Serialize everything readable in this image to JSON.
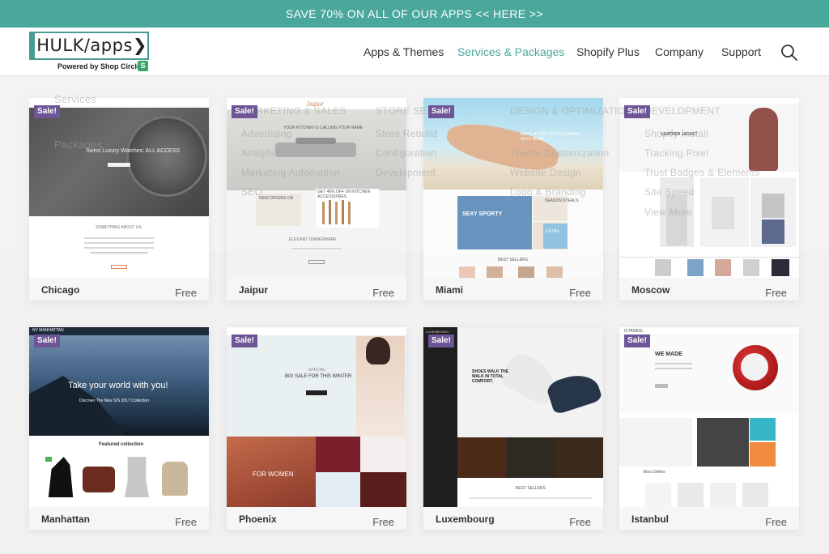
{
  "promo": {
    "text": "SAVE 70% ON ALL OF OUR APPS << HERE >>"
  },
  "brand": {
    "logo": "HULK/apps",
    "chevron": "❯",
    "sub": "Powered by Shop Circle",
    "badge": "S"
  },
  "nav": [
    {
      "label": "Apps & Themes"
    },
    {
      "label": "Services & Packages"
    },
    {
      "label": "Shopify Plus"
    },
    {
      "label": "Company"
    },
    {
      "label": "Support"
    }
  ],
  "menu": {
    "col1": [
      "Services",
      "Packages"
    ],
    "headings": [
      "MARKETING & SALES",
      "STORE SETUP",
      "DESIGN & OPTIMIZATION",
      "DEVELOPMENT"
    ],
    "marketing": [
      "Advertising",
      "Analytics",
      "Marketing Automation",
      "SEO"
    ],
    "setup": [
      "Store Rebuild",
      "Configuration",
      "Development"
    ],
    "design": [
      "Theme Customization",
      "Website Design",
      "Logo & Branding"
    ],
    "dev": [
      "Shopify Install",
      "Tracking Pixel",
      "Trust Badges & Elements",
      "Site Speed",
      "View More"
    ]
  },
  "badge": {
    "sale": "Sale!"
  },
  "themes": [
    {
      "name": "Chicago",
      "price": "Free"
    },
    {
      "name": "Jaipur",
      "price": "Free"
    },
    {
      "name": "Miami",
      "price": "Free"
    },
    {
      "name": "Moscow",
      "price": "Free"
    },
    {
      "name": "Manhattan",
      "price": "Free"
    },
    {
      "name": "Phoenix",
      "price": "Free"
    },
    {
      "name": "Luxembourg",
      "price": "Free"
    },
    {
      "name": "Istanbul",
      "price": "Free"
    }
  ],
  "previews": {
    "chicago": {
      "hero": "Swiss Luxury Watches: ALL ACCESS",
      "section": "SOMETHING ABOUT US"
    },
    "jaipur": {
      "logo": "Jaipur",
      "hero": "YOUR KITCHEN IS CALLING YOUR NAME",
      "offer1": "GET 40% OFF ON KITCHEN ACCESSORIES",
      "offer2": "NEW OFFERS ON",
      "footer": "ELEGANT DINNERWARE"
    },
    "miami": {
      "hero": "MAKE IT EASY. ELITE SUMMER SEXY BIKINI",
      "promo": "SEXY SPORTY",
      "tag1": "SEASON STEALS",
      "tag2": "EXTRA",
      "section": "BEST SELLERS"
    },
    "moscow": {
      "hero": "LEATHER JACKET"
    },
    "manhattan": {
      "logo": "NY MANHATTAN",
      "hero": "Take your world with you!",
      "sub": "Discover The New S/S 2017 Collection",
      "section": "Featured collection"
    },
    "phoenix": {
      "tag": "SPECIAL",
      "hero": "BIG SALE FOR THIS WINTER",
      "women": "FOR WOMEN"
    },
    "luxembourg": {
      "logo": "LUXEMBOURG",
      "hero": "SHOES WALK THE WALK IN TOTAL COMFORT.",
      "section": "BEST SELLERS"
    },
    "istanbul": {
      "logo": "ISTANBUL",
      "hero": "WE MADE",
      "section": "Best Sellers"
    }
  },
  "colors": {
    "accent": "#4aa79c",
    "sale": "#6e5696",
    "logo": "#4a9b93"
  }
}
